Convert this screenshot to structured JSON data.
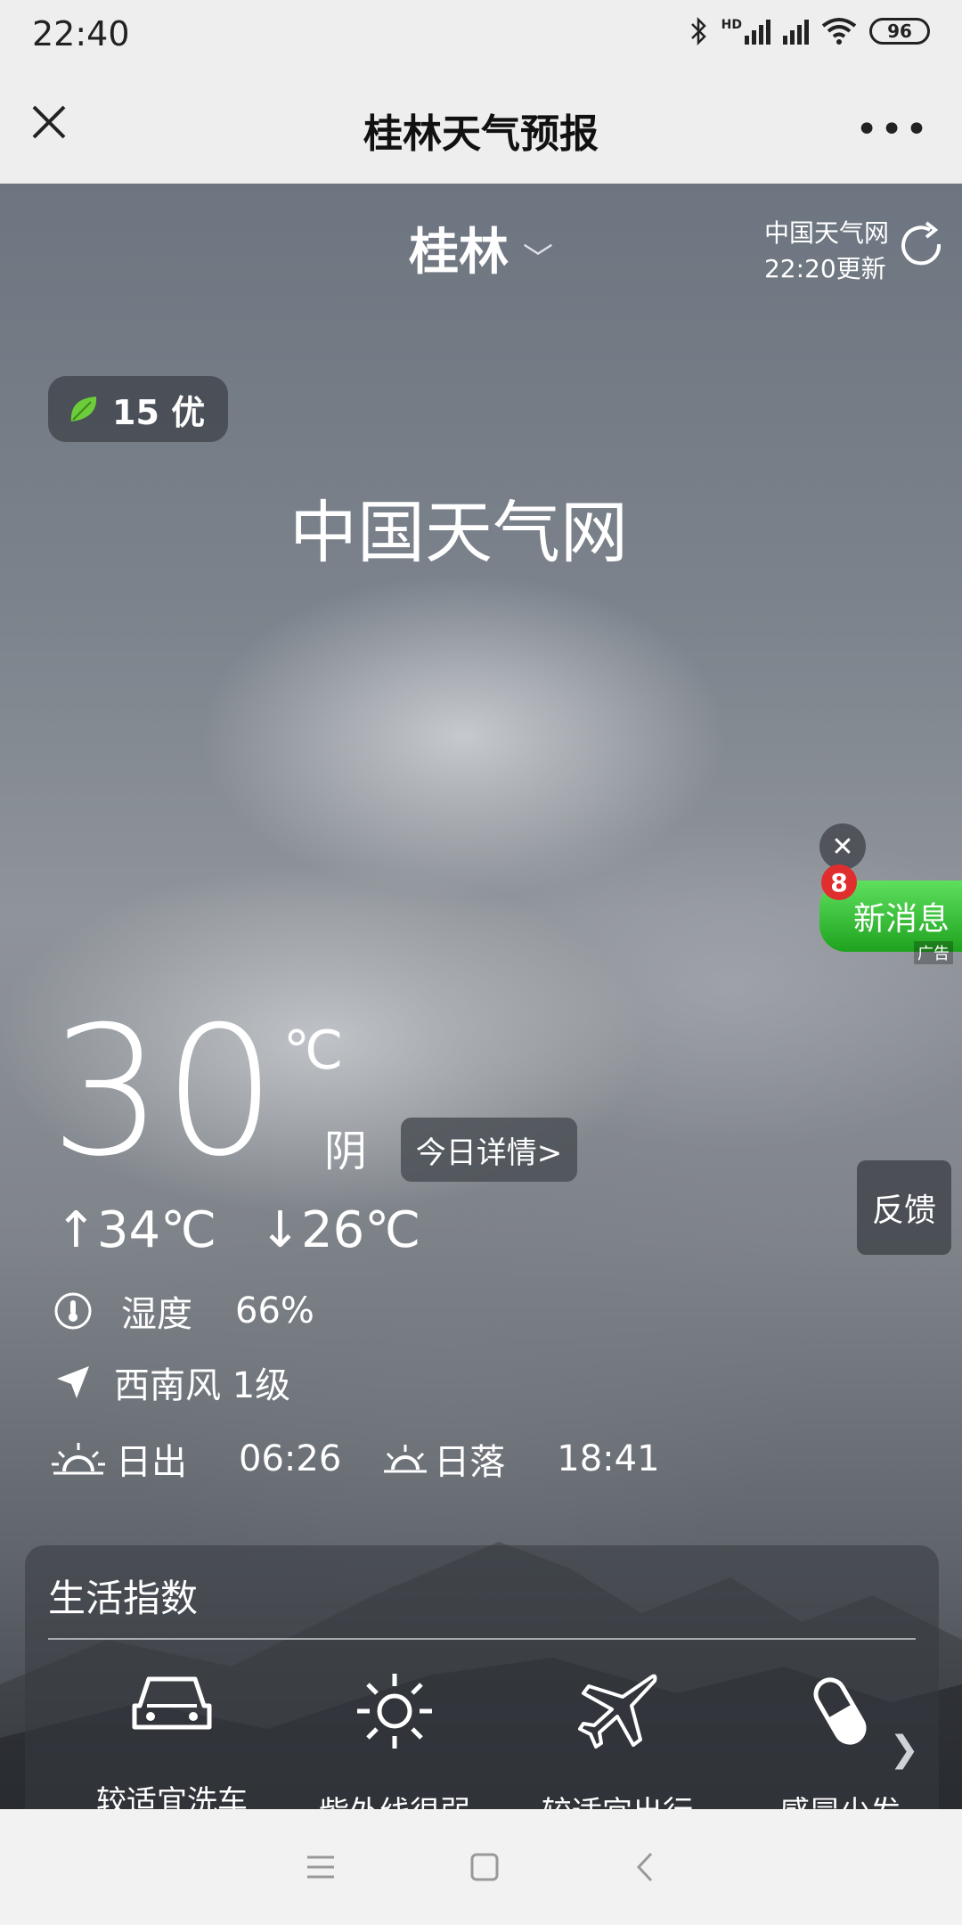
{
  "status_bar": {
    "time": "22:40",
    "battery": "96",
    "net_label": "HD"
  },
  "title_bar": {
    "title": "桂林天气预报",
    "more": "•••"
  },
  "weather": {
    "city": "桂林",
    "source_name": "中国天气网",
    "update_time": "22:20更新",
    "aqi": "15 优",
    "brand": "中国天气网",
    "temperature": "30",
    "unit": "℃",
    "condition": "阴",
    "detail_button": "今日详情>",
    "high": "↑34℃",
    "low": "↓26℃",
    "humidity_label": "湿度",
    "humidity_value": "66%",
    "wind": "西南风 1级",
    "sunrise_label": "日出",
    "sunrise_time": "06:26",
    "sunset_label": "日落",
    "sunset_time": "18:41"
  },
  "ad": {
    "label": "新消息",
    "count": "8",
    "tag": "广告",
    "close": "✕"
  },
  "feedback": "反馈",
  "life_index": {
    "header": "生活指数",
    "items": [
      {
        "icon": "car-icon",
        "label": "较适宜洗车"
      },
      {
        "icon": "sun-icon",
        "label": "紫外线很弱"
      },
      {
        "icon": "plane-icon",
        "label": "较适宜出行"
      },
      {
        "icon": "pill-icon",
        "label": "感冒少发"
      }
    ]
  },
  "colors": {
    "ad_green": "#2fbf2f",
    "badge_red": "#e02e2e",
    "aqi_leaf": "#6ccc3a"
  }
}
